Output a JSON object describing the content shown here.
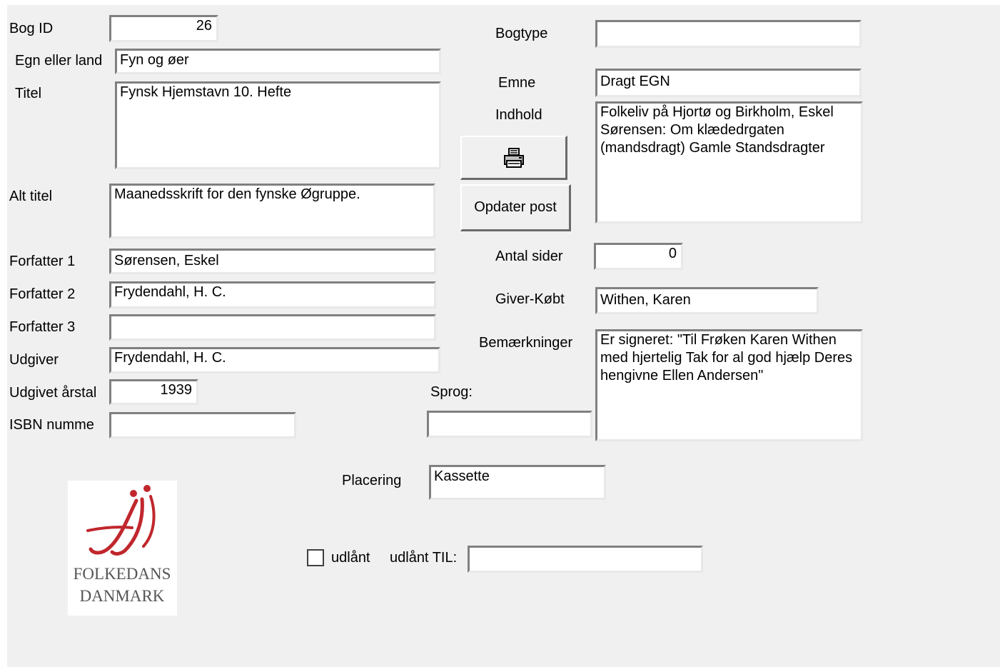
{
  "fields": {
    "bog_id": {
      "label": "Bog ID",
      "value": "26"
    },
    "egn": {
      "label": "Egn eller land",
      "value": "Fyn og øer"
    },
    "titel": {
      "label": "Titel",
      "value": "Fynsk Hjemstavn 10. Hefte"
    },
    "alt_titel": {
      "label": "Alt titel",
      "value": "Maanedsskrift for den fynske Øgruppe."
    },
    "forfatter1": {
      "label": "Forfatter 1",
      "value": "Sørensen, Eskel"
    },
    "forfatter2": {
      "label": "Forfatter 2",
      "value": "Frydendahl, H. C."
    },
    "forfatter3": {
      "label": "Forfatter 3",
      "value": ""
    },
    "udgiver": {
      "label": "Udgiver",
      "value": "Frydendahl, H. C."
    },
    "udgivet_aar": {
      "label": "Udgivet årstal",
      "value": "1939"
    },
    "isbn": {
      "label": "ISBN numme",
      "value": ""
    },
    "bogtype": {
      "label": "Bogtype",
      "value": ""
    },
    "emne": {
      "label": "Emne",
      "value": "Dragt EGN"
    },
    "indhold": {
      "label": "Indhold",
      "value": "Folkeliv på Hjortø og Birkholm, Eskel Sørensen: Om klædedrgaten (mandsdragt) Gamle Standsdragter"
    },
    "antal_sider": {
      "label": "Antal sider",
      "value": "0"
    },
    "giver": {
      "label": "Giver-Købt",
      "value": "Withen, Karen"
    },
    "bemaerkninger": {
      "label": "Bemærkninger",
      "value": "Er signeret: \"Til Frøken Karen Withen med hjertelig Tak for al god hjælp Deres hengivne Ellen Andersen\""
    },
    "sprog": {
      "label": "Sprog:",
      "value": ""
    },
    "placering": {
      "label": "Placering",
      "value": "Kassette"
    },
    "udlant_til": {
      "label": "udlånt TIL:",
      "value": ""
    }
  },
  "checkbox": {
    "label": "udlånt",
    "checked": false
  },
  "buttons": {
    "print_icon": "printer-icon",
    "update_label": "Opdater post"
  },
  "logo": {
    "line1": "FOLKEDANS",
    "line2": "DANMARK",
    "color_red": "#c0272d",
    "color_text": "#555555"
  }
}
